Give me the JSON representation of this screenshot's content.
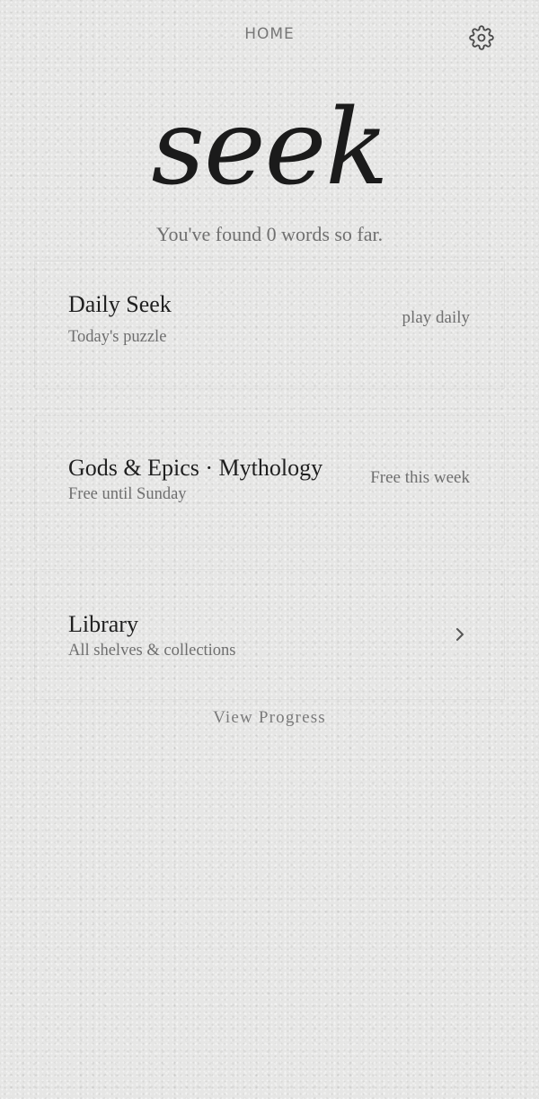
{
  "header": {
    "title": "HOME",
    "settings_icon": "gear-icon"
  },
  "hero": {
    "logo": "seek",
    "found_text": "You've found 0 words so far."
  },
  "cards": {
    "daily": {
      "title": "Daily Seek",
      "subtitle": "Today's puzzle",
      "action": "play daily"
    },
    "featured": {
      "title": "Gods & Epics · Mythology",
      "subtitle": "Free until Sunday",
      "badge": "Free this week"
    },
    "library": {
      "title": "Library",
      "subtitle": "All shelves & collections",
      "icon": "chevron-right-icon"
    }
  },
  "footer": {
    "view_progress": "View Progress"
  },
  "colors": {
    "background": "#e6e6e5",
    "text_primary": "#1f1f1f",
    "text_secondary": "#6f6f6f"
  }
}
